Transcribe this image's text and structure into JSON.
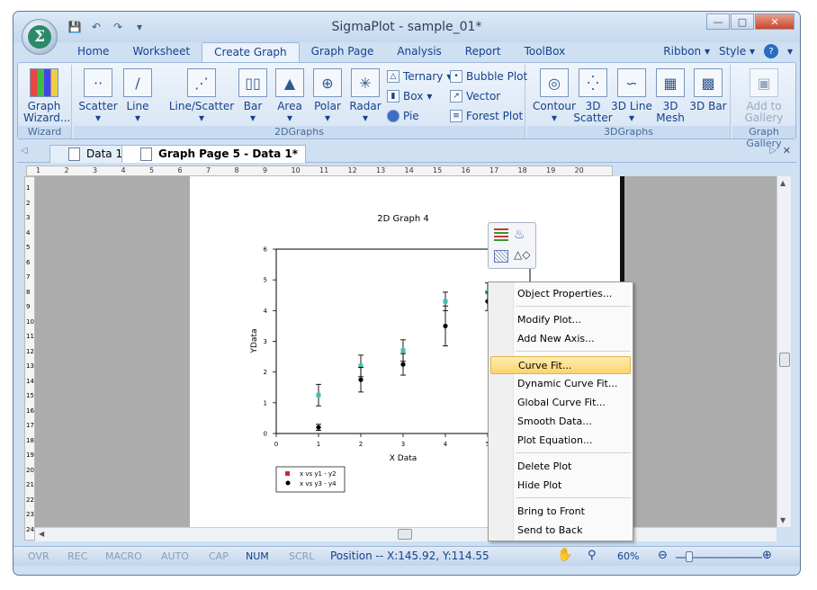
{
  "window": {
    "title": "SigmaPlot - sample_01*"
  },
  "ribbon": {
    "tabs": [
      "Home",
      "Worksheet",
      "Create Graph",
      "Graph Page",
      "Analysis",
      "Report",
      "ToolBox"
    ],
    "active_tab": "Create Graph",
    "right": {
      "ribbon": "Ribbon",
      "style": "Style",
      "help": "?"
    },
    "wizard_group": {
      "button": "Graph Wizard...",
      "label": "Wizard"
    },
    "twod_group": {
      "scatter": "Scatter",
      "line": "Line",
      "line_scatter": "Line/Scatter",
      "bar": "Bar",
      "area": "Area",
      "polar": "Polar",
      "radar": "Radar",
      "ternary": "Ternary",
      "box": "Box",
      "pie": "Pie",
      "bubble": "Bubble Plot",
      "vector": "Vector",
      "forest": "Forest Plot",
      "label": "2DGraphs"
    },
    "threed_group": {
      "contour": "Contour",
      "scatter3d": "3D Scatter",
      "line3d": "3D Line",
      "mesh3d": "3D Mesh",
      "bar3d": "3D Bar",
      "label": "3DGraphs"
    },
    "gallery_group": {
      "button": "Add to Gallery",
      "label": "Graph Gallery"
    }
  },
  "doc_tabs": [
    {
      "label": "Data 1*"
    },
    {
      "label": "Graph Page 5 - Data 1*"
    }
  ],
  "ruler_labels": [
    "1",
    "2",
    "3",
    "4",
    "5",
    "6",
    "7",
    "8",
    "9",
    "10",
    "11",
    "12",
    "13",
    "14",
    "15",
    "16",
    "17",
    "18",
    "19",
    "20"
  ],
  "vruler_labels": [
    "1",
    "2",
    "3",
    "4",
    "5",
    "6",
    "7",
    "8",
    "9",
    "10",
    "11",
    "12",
    "13",
    "14",
    "15",
    "16",
    "17",
    "18",
    "19",
    "20",
    "21",
    "22",
    "23",
    "24"
  ],
  "graph": {
    "title": "2D Graph 4",
    "xlabel": "X Data",
    "ylabel": "YData",
    "legend": [
      "x vs y1 - y2",
      "x vs y3 - y4"
    ]
  },
  "chart_data": {
    "type": "scatter",
    "title": "2D Graph 4",
    "xlabel": "X Data",
    "ylabel": "YData",
    "xlim": [
      0,
      6
    ],
    "ylim": [
      0,
      6
    ],
    "xticks": [
      0,
      1,
      2,
      3,
      4,
      5
    ],
    "yticks": [
      0,
      1,
      2,
      3,
      4,
      5,
      6
    ],
    "series": [
      {
        "name": "x vs y1 - y2",
        "color": "#40c0b0",
        "marker": "square",
        "x": [
          1,
          2,
          3,
          4,
          5
        ],
        "y": [
          1.25,
          2.2,
          2.7,
          4.3,
          4.6
        ],
        "err": [
          0.35,
          0.35,
          0.35,
          0.3,
          0.3
        ]
      },
      {
        "name": "x vs y3 - y4",
        "color": "#000000",
        "marker": "circle",
        "x": [
          1,
          2,
          3,
          4,
          5
        ],
        "y": [
          0.2,
          1.75,
          2.25,
          3.5,
          4.3
        ],
        "err": [
          0.1,
          0.4,
          0.35,
          0.65,
          0.3
        ]
      }
    ]
  },
  "context_menu": [
    {
      "label": "Object Properties..."
    },
    {
      "label": "Modify Plot..."
    },
    {
      "label": "Add New Axis..."
    },
    {
      "label": "Curve Fit...",
      "highlighted": true
    },
    {
      "label": "Dynamic Curve Fit..."
    },
    {
      "label": "Global Curve Fit..."
    },
    {
      "label": "Smooth Data..."
    },
    {
      "label": "Plot Equation..."
    },
    {
      "label": "Delete Plot"
    },
    {
      "label": "Hide Plot"
    },
    {
      "label": "Bring to Front"
    },
    {
      "label": "Send to Back"
    }
  ],
  "status": {
    "ovr": "OVR",
    "rec": "REC",
    "macro": "MACRO",
    "auto": "AUTO",
    "cap": "CAP",
    "num": "NUM",
    "scrl": "SCRL",
    "position": "Position -- X:145.92, Y:114.55",
    "zoom": "60%"
  }
}
